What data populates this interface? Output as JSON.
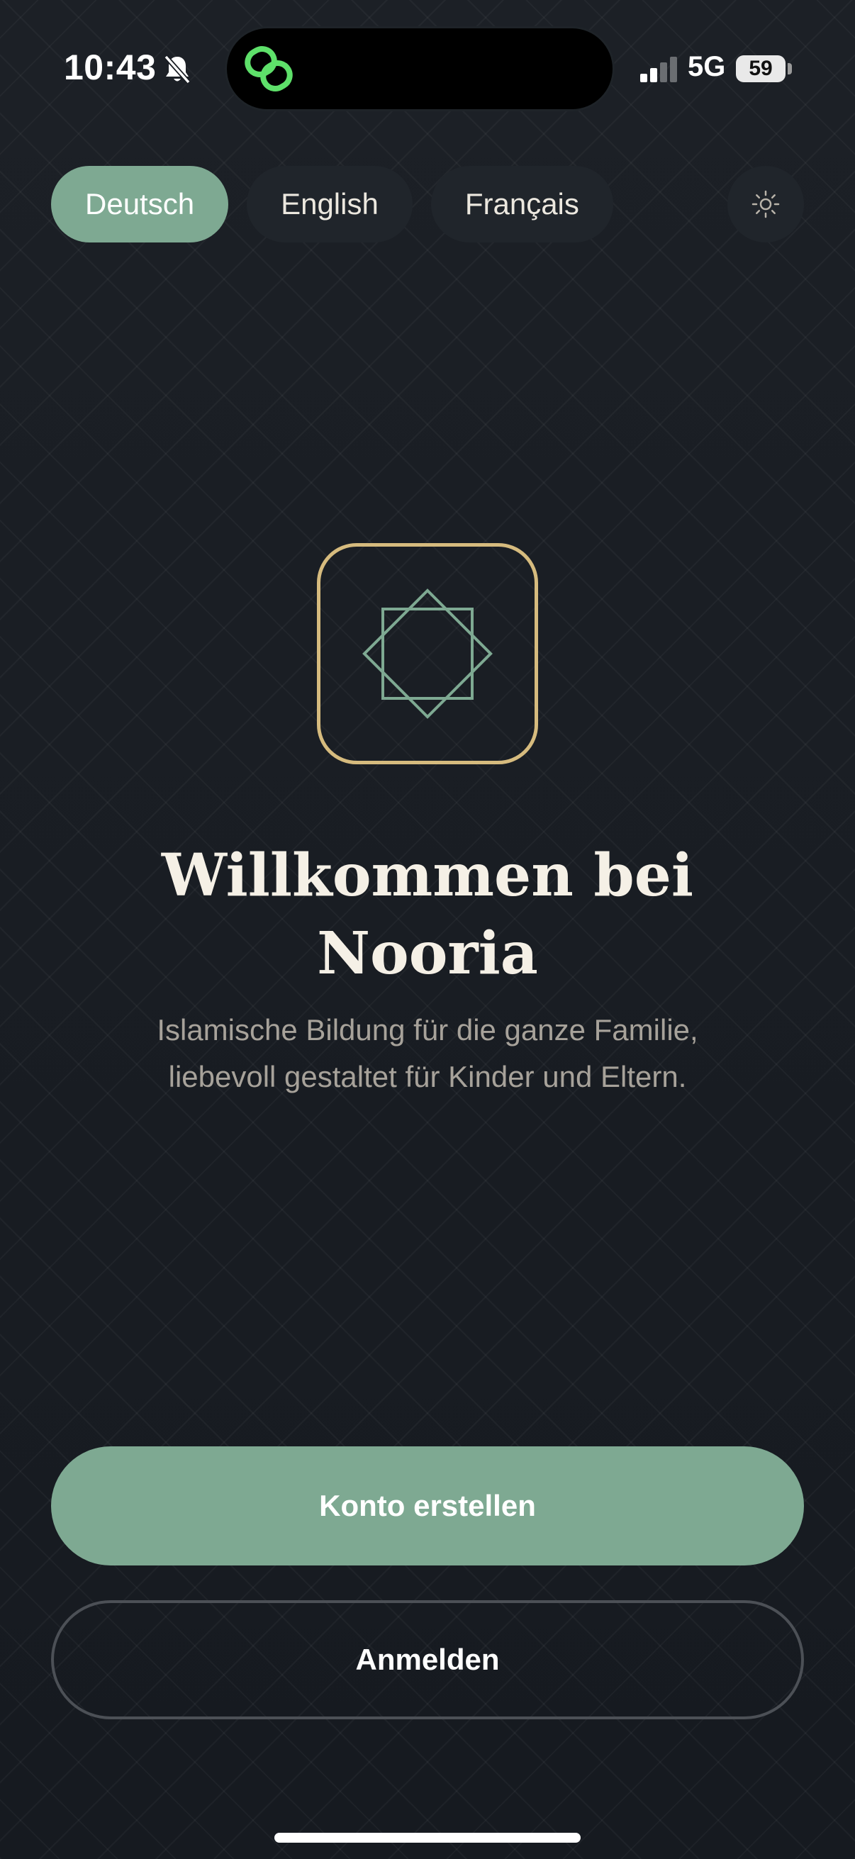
{
  "status_bar": {
    "time": "10:43",
    "network": "5G",
    "battery": "59",
    "icons": [
      "bell-slash-icon",
      "link-icon",
      "signal-icon",
      "battery-icon"
    ]
  },
  "languages": [
    {
      "label": "Deutsch",
      "active": true
    },
    {
      "label": "English",
      "active": false
    },
    {
      "label": "Français",
      "active": false
    }
  ],
  "theme_toggle": {
    "icon": "sun-icon"
  },
  "logo": {
    "icon": "eight-point-star-icon",
    "border_color": "#d6bb7e",
    "star_color": "#7ea992"
  },
  "welcome": {
    "title_line1": "Willkommen bei",
    "title_line2": "Nooria",
    "subtitle": "Islamische Bildung für die ganze Familie, liebevoll gestaltet für Kinder und Eltern."
  },
  "actions": {
    "create_account": "Konto erstellen",
    "sign_in": "Anmelden"
  },
  "colors": {
    "accent": "#7ea992",
    "gold": "#d6bb7e",
    "background": "#181c22"
  }
}
